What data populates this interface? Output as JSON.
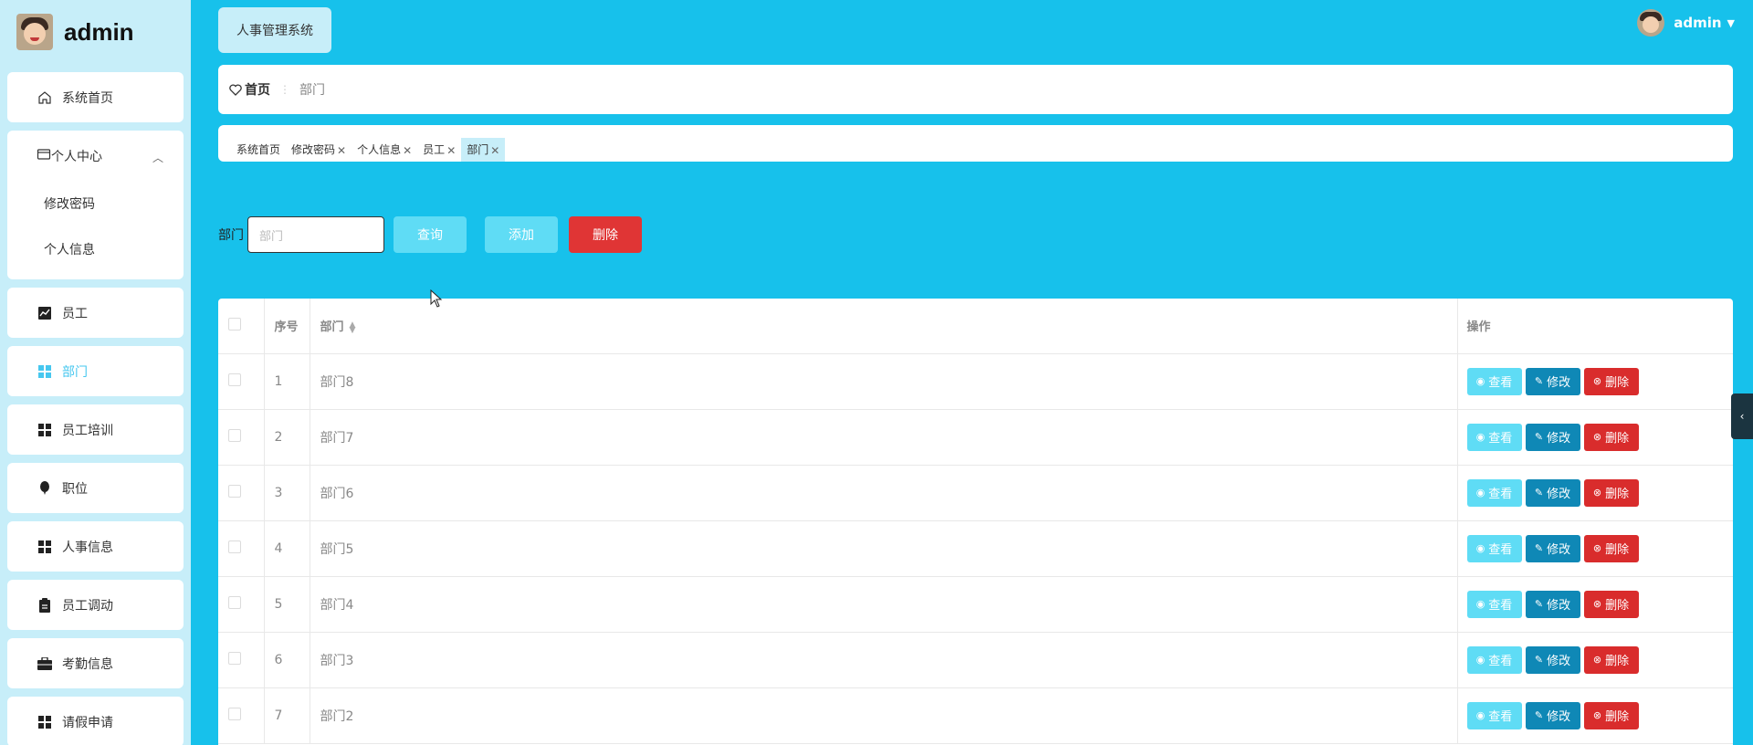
{
  "brand": {
    "name": "admin"
  },
  "header": {
    "system_title": "人事管理系统",
    "user_name": "admin"
  },
  "sidebar": {
    "items": [
      {
        "label": "系统首页",
        "icon": "home-icon"
      },
      {
        "label": "个人中心",
        "icon": "card-icon",
        "expanded": true,
        "children": [
          {
            "label": "修改密码"
          },
          {
            "label": "个人信息"
          }
        ]
      },
      {
        "label": "员工",
        "icon": "chart-icon"
      },
      {
        "label": "部门",
        "icon": "grid-icon",
        "active": true
      },
      {
        "label": "员工培训",
        "icon": "grid-icon"
      },
      {
        "label": "职位",
        "icon": "balloon-icon"
      },
      {
        "label": "人事信息",
        "icon": "grid-icon"
      },
      {
        "label": "员工调动",
        "icon": "clipboard-icon"
      },
      {
        "label": "考勤信息",
        "icon": "briefcase-icon"
      },
      {
        "label": "请假申请",
        "icon": "grid-icon"
      }
    ]
  },
  "breadcrumb": {
    "home": "首页",
    "current": "部门"
  },
  "tags": [
    {
      "label": "系统首页",
      "closable": false
    },
    {
      "label": "修改密码",
      "closable": true
    },
    {
      "label": "个人信息",
      "closable": true
    },
    {
      "label": "员工",
      "closable": true
    },
    {
      "label": "部门",
      "closable": true,
      "active": true
    }
  ],
  "search": {
    "label": "部门",
    "placeholder": "部门",
    "query_label": "查询",
    "add_label": "添加",
    "delete_label": "删除"
  },
  "table": {
    "columns": {
      "index": "序号",
      "name": "部门",
      "ops": "操作"
    },
    "rows": [
      {
        "index": "1",
        "name": "部门8"
      },
      {
        "index": "2",
        "name": "部门7"
      },
      {
        "index": "3",
        "name": "部门6"
      },
      {
        "index": "4",
        "name": "部门5"
      },
      {
        "index": "5",
        "name": "部门4"
      },
      {
        "index": "6",
        "name": "部门3"
      },
      {
        "index": "7",
        "name": "部门2"
      }
    ],
    "row_actions": {
      "view": "查看",
      "edit": "修改",
      "delete": "删除"
    }
  },
  "colors": {
    "main_bg": "#17c1eb",
    "sidebar_bg": "#c7eef9",
    "accent": "#46c7ef",
    "danger": "#e03535",
    "edit": "#0f88b6"
  }
}
